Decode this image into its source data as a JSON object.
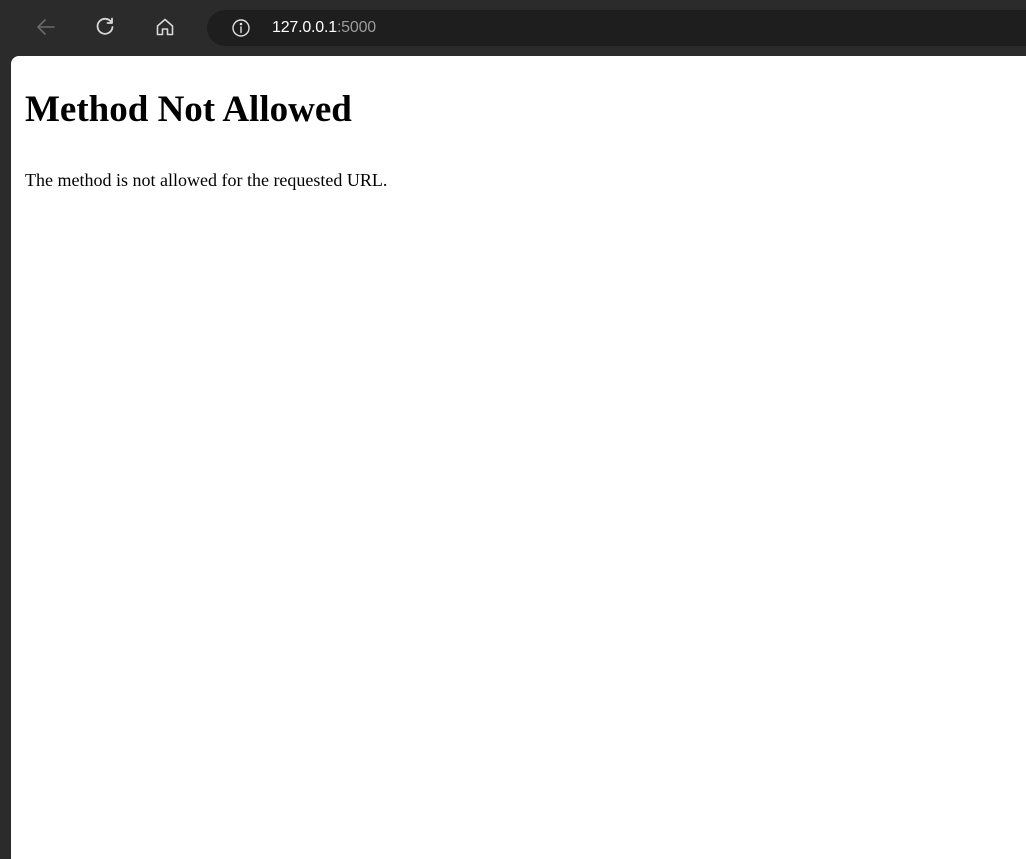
{
  "browser": {
    "theme": {
      "toolbar_bg": "#2b2b2b",
      "address_bar_bg": "#1e1e1e",
      "icon_color": "#d8d8d8",
      "icon_disabled_color": "#6a6a6a"
    },
    "icons": {
      "back": "arrow-left-icon",
      "reload": "reload-icon",
      "home": "home-icon",
      "site_info": "info-icon"
    },
    "address": {
      "host": "127.0.0.1",
      "port": ":5000"
    }
  },
  "page": {
    "title": "Method Not Allowed",
    "message": "The method is not allowed for the requested URL."
  }
}
